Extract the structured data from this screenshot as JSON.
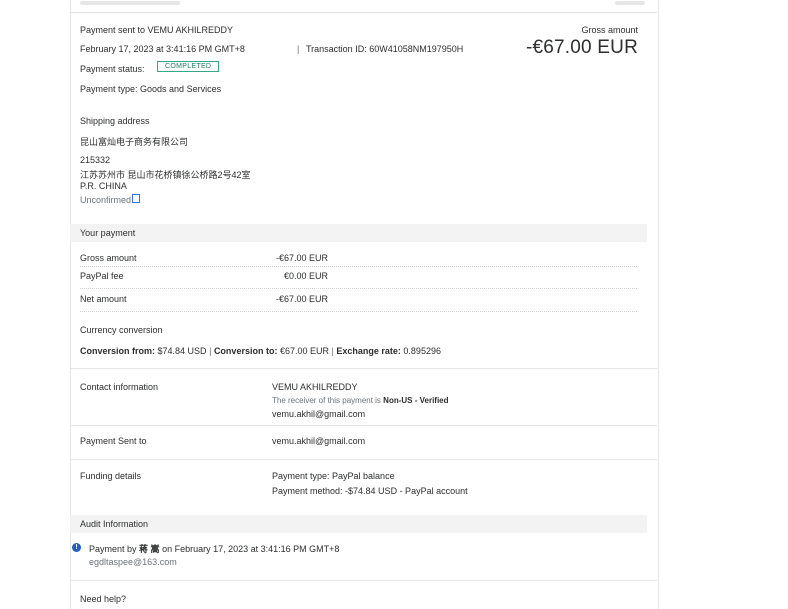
{
  "header": {
    "payment_sent_to": "Payment sent to VEMU AKHILREDDY",
    "date": "February 17, 2023 at 3:41:16 PM GMT+8",
    "separator": "|",
    "transaction_id": "Transaction ID: 60W41058NM197950H",
    "payment_status_label": "Payment status:",
    "payment_status": "COMPLETED",
    "payment_type": "Payment type: Goods and Services",
    "gross_amount_label": "Gross amount",
    "gross_amount": "-€67.00 EUR"
  },
  "shipping": {
    "label": "Shipping address",
    "company": "昆山富灿电子商务有限公司",
    "postal_code": "215332",
    "street": "江苏苏州市 昆山市花桥镇徐公桥路2号42室",
    "country": "P.R. CHINA",
    "status": "Unconfirmed"
  },
  "your_payment": {
    "heading": "Your payment",
    "rows": [
      {
        "label": "Gross amount",
        "value": "-€67.00 EUR"
      },
      {
        "label": "PayPal fee",
        "value": "€0.00 EUR"
      },
      {
        "label": "Net amount",
        "value": "-€67.00 EUR"
      }
    ]
  },
  "currency": {
    "label": "Currency conversion",
    "from_label": "Conversion from:",
    "from_value": "$74.84 USD",
    "to_label": "Conversion to:",
    "to_value": "€67.00 EUR",
    "rate_label": "Exchange rate:",
    "rate_value": "0.895296",
    "sep": "|"
  },
  "contact": {
    "label": "Contact information",
    "name": "VEMU AKHILREDDY",
    "receiver_note": "The receiver of this payment is",
    "receiver_status": "Non-US - Verified",
    "email": "vemu.akhil@gmail.com"
  },
  "sent_to": {
    "label": "Payment Sent to",
    "email": "vemu.akhil@gmail.com"
  },
  "funding": {
    "label": "Funding details",
    "type": "Payment type: PayPal balance",
    "method": "Payment method: -$74.84 USD - PayPal account"
  },
  "audit": {
    "heading": "Audit Information",
    "prefix": "Payment by",
    "name": "蒋 嵩",
    "suffix": "on February 17, 2023 at 3:41:16 PM GMT+8",
    "email": "egdltaspee@163.com"
  },
  "help": {
    "label": "Need help?"
  },
  "colors": {
    "status_green": "#33a98a",
    "section_bg": "#f3f3f3",
    "info_blue": "#1f5fbf",
    "text": "#2c2e2f"
  },
  "icons": [
    "info-icon",
    "unconfirmed-marker-icon"
  ]
}
